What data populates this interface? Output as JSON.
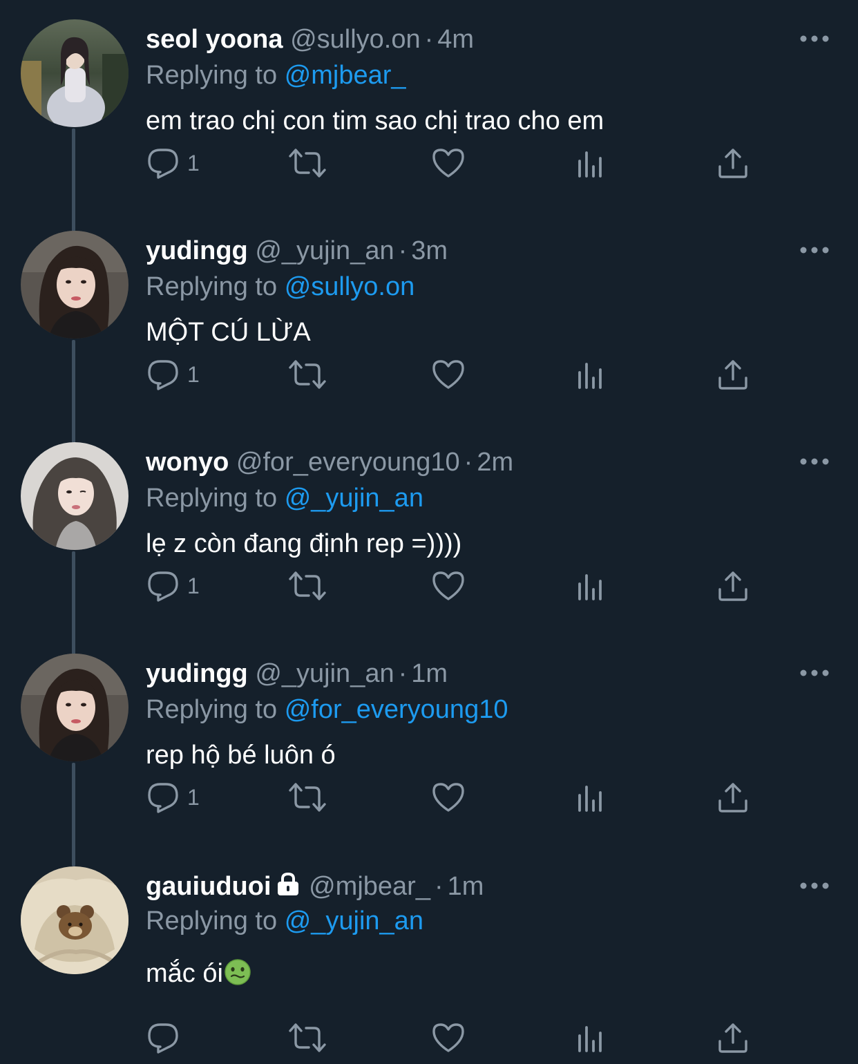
{
  "colors": {
    "background": "#15202b",
    "primary_text": "#ffffff",
    "secondary_text": "#8b98a5",
    "link": "#1d9bf0",
    "thread_line": "#3d4e5e"
  },
  "tweets": [
    {
      "display_name": "seol yoona",
      "handle": "@sullyo.on",
      "separator": "·",
      "time": "4m",
      "replying_label": "Replying to",
      "replying_to": "@mjbear_",
      "text": "em trao chị con tim sao chị trao cho em",
      "reply_count": "1",
      "avatar_icon": "profile-photo"
    },
    {
      "display_name": "yudingg",
      "handle": "@_yujin_an",
      "separator": "·",
      "time": "3m",
      "replying_label": "Replying to",
      "replying_to": "@sullyo.on",
      "text": "MỘT CÚ LỪA",
      "reply_count": "1",
      "avatar_icon": "profile-photo"
    },
    {
      "display_name": "wonyo",
      "handle": "@for_everyoung10",
      "separator": "·",
      "time": "2m",
      "replying_label": "Replying to",
      "replying_to": "@_yujin_an",
      "text": "lẹ z còn đang định rep =))))",
      "reply_count": "1",
      "avatar_icon": "profile-photo"
    },
    {
      "display_name": "yudingg",
      "handle": "@_yujin_an",
      "separator": "·",
      "time": "1m",
      "replying_label": "Replying to",
      "replying_to": "@for_everyoung10",
      "text": "rep hộ bé luôn ó",
      "reply_count": "1",
      "avatar_icon": "profile-photo"
    },
    {
      "display_name": "gauiuduoi",
      "handle": "@mjbear_",
      "separator": "·",
      "time": "1m",
      "replying_label": "Replying to",
      "replying_to": "@_yujin_an",
      "text": "mắc ói",
      "reply_count": "",
      "protected": true,
      "emoji": "nauseated-face-emoji",
      "avatar_icon": "profile-photo"
    }
  ],
  "icons": {
    "more": "more-dots-icon",
    "reply": "reply-icon",
    "retweet": "retweet-icon",
    "like": "heart-icon",
    "views": "views-icon",
    "share": "share-icon",
    "lock": "lock-icon"
  }
}
